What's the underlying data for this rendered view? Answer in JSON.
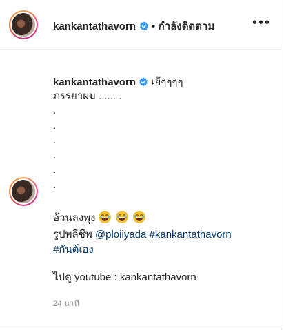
{
  "header": {
    "username": "kankantathavorn",
    "separator": "•",
    "follow_status": "กำลังติดตาม",
    "more_label": "•••"
  },
  "caption": {
    "username": "kankantathavorn",
    "text_first": "เย้ๆๆๆๆ",
    "line2": "ภรรยาผม ...... .",
    "dots": [
      ".",
      ".",
      ".",
      ".",
      ".",
      "."
    ]
  },
  "comment": {
    "line1": "อ้วนลงพุง",
    "line2_prefix": "รูปพลีชีพ",
    "mention": "@ploiiyada",
    "hashtag1": "#kankantathavorn",
    "hashtag2": "#กันต์เอง",
    "line4": "ไปดู youtube : kankantathavorn",
    "timestamp": "24 นาที"
  },
  "colors": {
    "verified": "#3897f0",
    "link": "#00376b",
    "muted": "#8e8e8e"
  }
}
